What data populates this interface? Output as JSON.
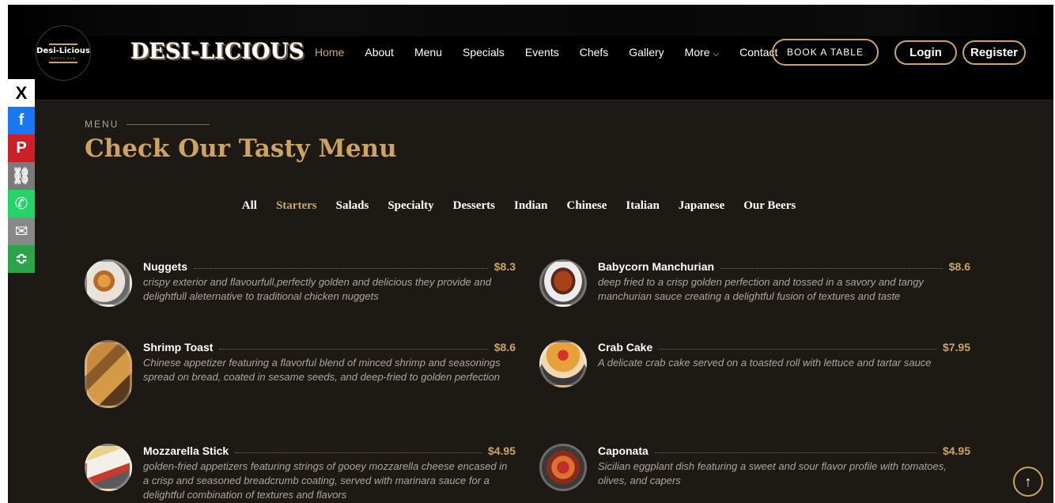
{
  "header": {
    "logo": {
      "name": "Desi-Licious",
      "sub": "RESTO-PUB"
    },
    "brand": "DESI-LICIOUS",
    "nav": [
      {
        "label": "Home",
        "active": true
      },
      {
        "label": "About"
      },
      {
        "label": "Menu"
      },
      {
        "label": "Specials"
      },
      {
        "label": "Events"
      },
      {
        "label": "Chefs"
      },
      {
        "label": "Gallery"
      },
      {
        "label": "More"
      },
      {
        "label": "Contact"
      }
    ],
    "book_table": "BOOK A TABLE",
    "login": "Login",
    "register": "Register"
  },
  "social": [
    {
      "name": "x-icon",
      "glyph": "X"
    },
    {
      "name": "facebook-icon",
      "glyph": "f"
    },
    {
      "name": "pinterest-icon",
      "glyph": "P"
    },
    {
      "name": "copy-link-icon",
      "glyph": "⛓"
    },
    {
      "name": "whatsapp-icon",
      "glyph": "✆"
    },
    {
      "name": "email-icon",
      "glyph": "✉"
    },
    {
      "name": "more-share-icon",
      "glyph": "≎"
    }
  ],
  "section": {
    "eyebrow": "MENU",
    "title": "Check Our Tasty Menu"
  },
  "filters": [
    {
      "label": "All"
    },
    {
      "label": "Starters",
      "active": true
    },
    {
      "label": "Salads"
    },
    {
      "label": "Specialty"
    },
    {
      "label": "Desserts"
    },
    {
      "label": "Indian"
    },
    {
      "label": "Chinese"
    },
    {
      "label": "Italian"
    },
    {
      "label": "Japanese"
    },
    {
      "label": "Our Beers"
    }
  ],
  "items": [
    {
      "name": "Nuggets",
      "price": "$8.3",
      "desc": "crispy exterior and flavourfull,perfectly golden and delicious they provide and delightfull aleternative to traditional chicken nuggets"
    },
    {
      "name": "Babycorn Manchurian",
      "price": "$8.6",
      "desc": "deep fried to a crisp golden perfection and tossed in a savory and tangy manchurian sauce creating a delightful fusion of textures and taste"
    },
    {
      "name": "Shrimp Toast",
      "price": "$8.6",
      "desc": "Chinese appetizer featuring a flavorful blend of minced shrimp and seasonings spread on bread, coated in sesame seeds, and deep-fried to golden perfection"
    },
    {
      "name": "Crab Cake",
      "price": "$7.95",
      "desc": "A delicate crab cake served on a toasted roll with lettuce and tartar sauce"
    },
    {
      "name": "Mozzarella Stick",
      "price": "$4.95",
      "desc": "golden-fried appetizers featuring strings of gooey mozzarella cheese encased in a crisp and seasoned breadcrumb coating, served with marinara sauce for a delightful combination of textures and flavors"
    },
    {
      "name": "Caponata",
      "price": "$4.95",
      "desc": "Sicilian eggplant dish featuring a sweet and sour flavor profile with tomatoes, olives, and capers"
    }
  ],
  "scroll_top_icon": "↑"
}
